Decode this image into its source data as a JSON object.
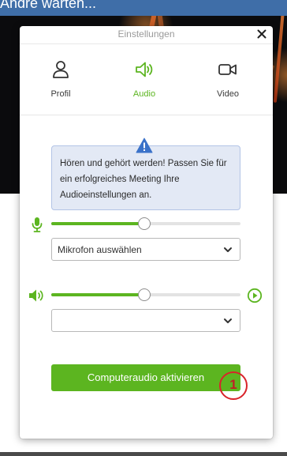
{
  "background": {
    "top_text": "Andre warten...",
    "colors": {
      "top_bar": "#3f6ea8",
      "video": "#0b0b0d"
    }
  },
  "dialog": {
    "title": "Einstellungen",
    "close_icon": "close-icon",
    "tabs": [
      {
        "label": "Profil",
        "icon": "user-icon",
        "active": false
      },
      {
        "label": "Audio",
        "icon": "speaker-icon",
        "active": true
      },
      {
        "label": "Video",
        "icon": "camera-icon",
        "active": false
      }
    ],
    "info": {
      "icon": "warning-icon",
      "text": "Hören und gehört werden! Passen Sie für ein erfolgreiches Meeting Ihre Audioeinstellungen an."
    },
    "microphone": {
      "icon": "microphone-icon",
      "level_percent": 49,
      "select_value": "Mikrofon auswählen"
    },
    "speaker": {
      "icon": "speaker-volume-icon",
      "level_percent": 49,
      "play_icon": "play-circle-icon",
      "select_value": ""
    },
    "primary_button": "Computeraudio aktivieren",
    "badge": "1",
    "colors": {
      "accent": "#5cb520",
      "info_bg": "#e3e9f5",
      "info_border": "#b3c4e6",
      "badge": "#d9232a"
    }
  }
}
